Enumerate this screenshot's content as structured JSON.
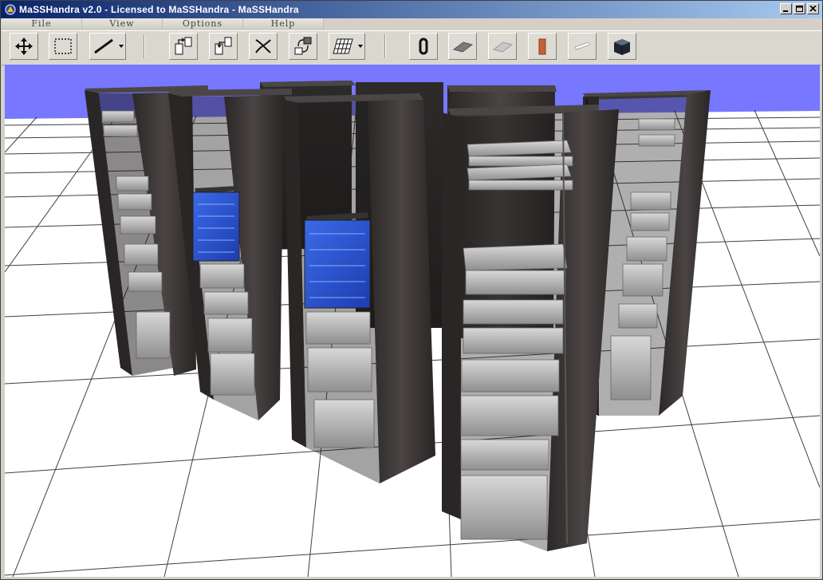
{
  "window": {
    "title": "MaSSHandra v2.0 - Licensed to MaSSHandra  - MaSSHandra"
  },
  "menu": {
    "items": [
      {
        "label": "File"
      },
      {
        "label": "View"
      },
      {
        "label": "Options"
      },
      {
        "label": "Help"
      }
    ]
  },
  "toolbar": {
    "tools": [
      {
        "name": "move-tool",
        "icon": "move-arrows-icon"
      },
      {
        "name": "select-tool",
        "icon": "selection-rectangle-icon"
      },
      {
        "name": "cable-tool",
        "icon": "cable-line-icon",
        "dropdown": true
      },
      {
        "name": "export-left-tool",
        "icon": "rack-export-left-icon"
      },
      {
        "name": "export-right-tool",
        "icon": "rack-export-right-icon"
      },
      {
        "name": "delete-link-tool",
        "icon": "cut-link-icon"
      },
      {
        "name": "swap-tool",
        "icon": "swap-devices-icon"
      },
      {
        "name": "grid-tool",
        "icon": "grid-floor-icon",
        "dropdown": true
      },
      {
        "name": "cable-ring-tool",
        "icon": "cable-ring-icon"
      },
      {
        "name": "dark-tile-tool",
        "icon": "dark-floor-tile-icon"
      },
      {
        "name": "light-tile-tool",
        "icon": "light-floor-tile-icon"
      },
      {
        "name": "door-tool",
        "icon": "door-panel-icon"
      },
      {
        "name": "white-panel-tool",
        "icon": "white-panel-icon"
      },
      {
        "name": "rack-cube-tool",
        "icon": "rack-cube-icon"
      }
    ]
  },
  "scene": {
    "sky_color": "#7777ff",
    "floor_color": "#ffffff",
    "grid_color": "#000000",
    "rack_color": "#3a3636",
    "screen_color": "#2d56d8"
  }
}
